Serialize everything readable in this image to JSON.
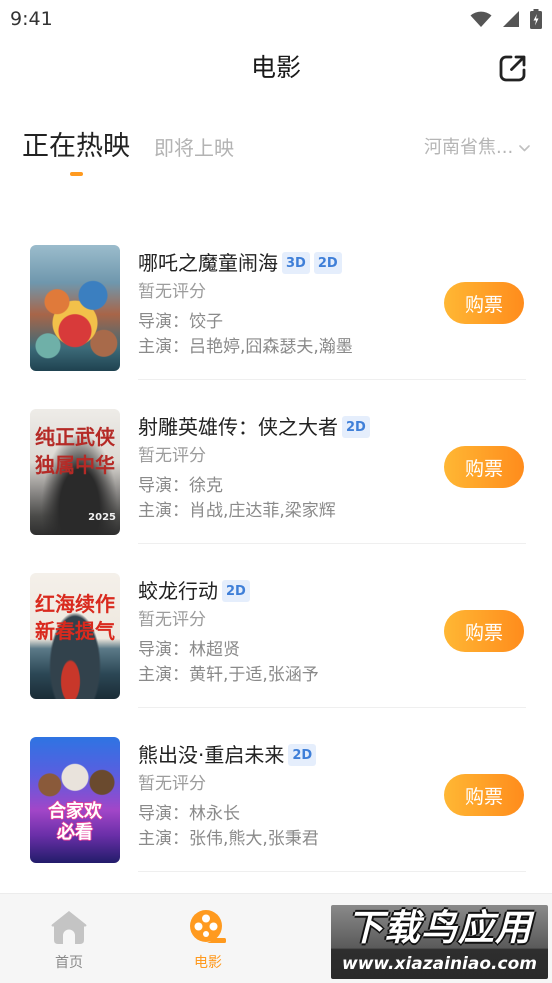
{
  "status_bar": {
    "time": "9:41"
  },
  "header": {
    "title": "电影"
  },
  "tabs": [
    {
      "label": "正在热映",
      "active": true
    },
    {
      "label": "即将上映",
      "active": false
    }
  ],
  "location": {
    "label": "河南省焦..."
  },
  "colors": {
    "accent": "#ff9a1f",
    "badge_bg": "#e5eefc",
    "badge_text": "#3f7fd8",
    "buy_gradient_start": "#ffb734",
    "buy_gradient_end": "#ff8c1c",
    "nav_inactive": "#8a8a8a"
  },
  "movies": [
    {
      "title": "哪吒之魔童闹海",
      "formats": [
        "3D",
        "2D"
      ],
      "rating": "暂无评分",
      "director": "导演：饺子",
      "cast": "主演：吕艳婷,囧森瑟夫,瀚墨",
      "buy_label": "购票",
      "poster_text": []
    },
    {
      "title": "射雕英雄传：侠之大者",
      "formats": [
        "2D"
      ],
      "rating": "暂无评分",
      "director": "导演：徐克",
      "cast": "主演：肖战,庄达菲,梁家辉",
      "buy_label": "购票",
      "poster_text": [
        "纯正武侠",
        "独属中华",
        "2025"
      ]
    },
    {
      "title": "蛟龙行动",
      "formats": [
        "2D"
      ],
      "rating": "暂无评分",
      "director": "导演：林超贤",
      "cast": "主演：黄轩,于适,张涵予",
      "buy_label": "购票",
      "poster_text": [
        "红海续作",
        "新春提气"
      ]
    },
    {
      "title": "熊出没·重启未来",
      "formats": [
        "2D"
      ],
      "rating": "暂无评分",
      "director": "导演：林永长",
      "cast": "主演：张伟,熊大,张秉君",
      "buy_label": "购票",
      "poster_text": [
        "合家欢",
        "必看"
      ]
    }
  ],
  "bottom_nav": [
    {
      "label": "首页",
      "icon": "home-icon",
      "active": false
    },
    {
      "label": "电影",
      "icon": "film-icon",
      "active": true
    }
  ],
  "watermark": {
    "name": "下载鸟应用",
    "url": "www.xiazainiao.com"
  }
}
